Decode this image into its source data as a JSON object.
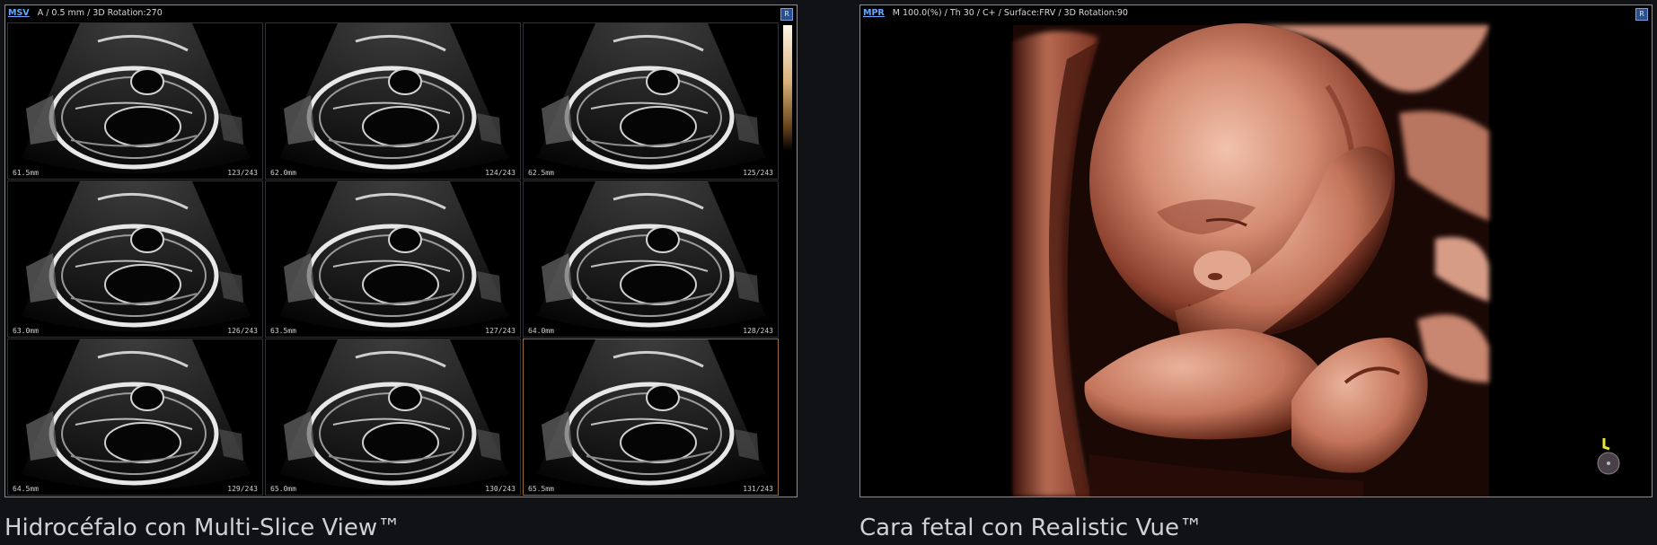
{
  "left_panel": {
    "mode_tag": "MSV",
    "header_text": "A / 0.5 mm / 3D Rotation:270",
    "corner_button": "R",
    "tiles": [
      {
        "depth": "61.5mm",
        "index": "123/243"
      },
      {
        "depth": "62.0mm",
        "index": "124/243"
      },
      {
        "depth": "62.5mm",
        "index": "125/243"
      },
      {
        "depth": "63.0mm",
        "index": "126/243"
      },
      {
        "depth": "63.5mm",
        "index": "127/243"
      },
      {
        "depth": "64.0mm",
        "index": "128/243"
      },
      {
        "depth": "64.5mm",
        "index": "129/243"
      },
      {
        "depth": "65.0mm",
        "index": "130/243"
      },
      {
        "depth": "65.5mm",
        "index": "131/243"
      }
    ],
    "caption": "Hidrocéfalo con Multi-Slice View™"
  },
  "right_panel": {
    "mode_tag": "MPR",
    "header_text": "M 100.0(%) / Th 30 / C+ / Surface:FRV / 3D Rotation:90",
    "corner_button": "R",
    "caption": "Cara fetal con Realistic Vue™"
  },
  "colors": {
    "panel_border": "#8a8d93",
    "mode_tag": "#69a8ff",
    "skin_tone": "#c9806a",
    "background": "#111215"
  }
}
